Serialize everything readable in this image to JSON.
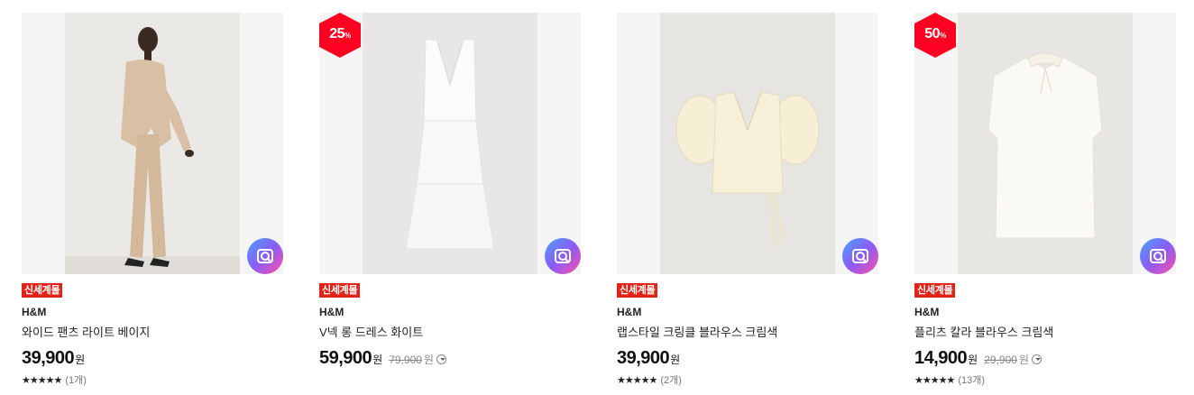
{
  "colors": {
    "tag": "#e2231a",
    "discount_badge": "#ff0022"
  },
  "products": [
    {
      "badge": "",
      "tag": "신세계몰",
      "brand": "H&M",
      "name": "와이드 팬츠 라이트 베이지",
      "price": "39,900",
      "currency": "원",
      "original_price": "",
      "rating_stars": "★★★★★",
      "review_count": "(1개)"
    },
    {
      "badge": "25",
      "badge_unit": "%",
      "tag": "신세계몰",
      "brand": "H&M",
      "name": "V넥 롱 드레스 화이트",
      "price": "59,900",
      "currency": "원",
      "original_price": "79,900",
      "original_currency": "원",
      "rating_stars": "",
      "review_count": ""
    },
    {
      "badge": "",
      "tag": "신세계몰",
      "brand": "H&M",
      "name": "랩스타일 크링클 블라우스 크림색",
      "price": "39,900",
      "currency": "원",
      "original_price": "",
      "rating_stars": "★★★★★",
      "review_count": "(2개)"
    },
    {
      "badge": "50",
      "badge_unit": "%",
      "tag": "신세계몰",
      "brand": "H&M",
      "name": "플리츠 칼라 블라우스 크림색",
      "price": "14,900",
      "currency": "원",
      "original_price": "29,900",
      "original_currency": "원",
      "rating_stars": "★★★★★",
      "review_count": "(13개)"
    }
  ]
}
